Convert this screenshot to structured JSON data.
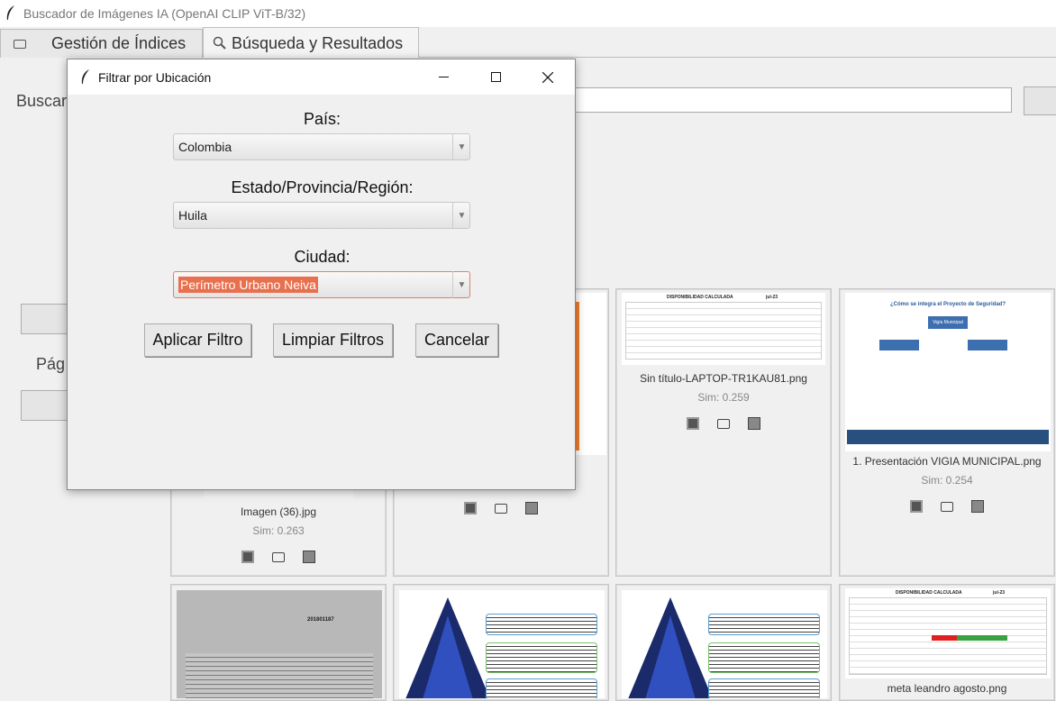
{
  "window": {
    "title": "Buscador de Imágenes IA (OpenAI CLIP ViT-B/32)",
    "icon": "feather-icon"
  },
  "tabs": [
    {
      "label": "Gestión de Índices",
      "icon": "folder-icon",
      "active": false
    },
    {
      "label": "Búsqueda y Resultados",
      "icon": "search-icon",
      "active": true
    }
  ],
  "search": {
    "label": "Buscar"
  },
  "sidebar": {
    "page_label": "Pág"
  },
  "results": [
    {
      "name": "Imagen (36).jpg",
      "sim": "Sim: 0.263"
    },
    {
      "name": "",
      "sim": ""
    },
    {
      "name": "Sin título-LAPTOP-TR1KAU81.png",
      "sim": "Sim: 0.259"
    },
    {
      "name": "1. Presentación VIGIA MUNICIPAL.png",
      "sim": "Sim: 0.254"
    },
    {
      "name": "",
      "sim": ""
    },
    {
      "name": "",
      "sim": ""
    },
    {
      "name": "",
      "sim": ""
    },
    {
      "name": "meta leandro agosto.png",
      "sim": ""
    }
  ],
  "thumb_text": {
    "disp_title": "DISPONIBILIDAD CALCULADA",
    "disp_month": "jul-23",
    "seg_title": "¿Cómo se integra el Proyecto de Seguridad?",
    "seg_node": "Vigía Municipal",
    "doc_number": "201801187"
  },
  "dialog": {
    "title": "Filtrar por Ubicación",
    "icon": "feather-icon",
    "country_label": "País:",
    "country_value": "Colombia",
    "state_label": "Estado/Provincia/Región:",
    "state_value": "Huila",
    "city_label": "Ciudad:",
    "city_value": "Perímetro Urbano Neiva",
    "apply_label": "Aplicar Filtro",
    "clear_label": "Limpiar Filtros",
    "cancel_label": "Cancelar"
  },
  "colors": {
    "selection": "#e8704e",
    "focus_border": "#e0806a",
    "accent_orange": "#f08030"
  }
}
